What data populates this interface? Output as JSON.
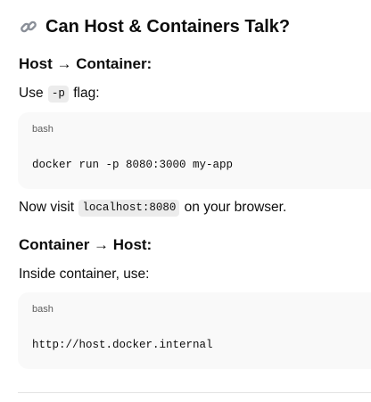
{
  "section": {
    "icon": "link-icon",
    "title": "Can Host & Containers Talk?"
  },
  "host_to_container": {
    "heading": "Host → Container:",
    "intro_before": "Use",
    "intro_code": "-p",
    "intro_after": "flag:",
    "code_block": {
      "language": "bash",
      "code": "docker run -p 8080:3000 my-app"
    },
    "visit_before": "Now visit",
    "visit_code": "localhost:8080",
    "visit_after": "on your browser."
  },
  "container_to_host": {
    "heading": "Container → Host:",
    "intro": "Inside container, use:",
    "code_block": {
      "language": "bash",
      "code": "http://host.docker.internal"
    }
  }
}
